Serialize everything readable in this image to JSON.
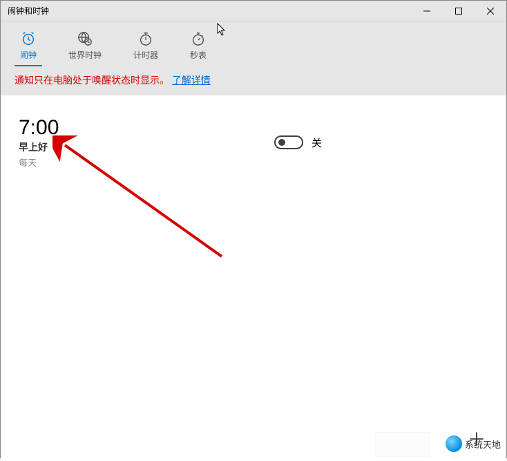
{
  "window": {
    "title": "闹钟和时钟"
  },
  "tabs": {
    "alarm": "闹钟",
    "world_clock": "世界时钟",
    "timer": "计时器",
    "stopwatch": "秒表"
  },
  "notice": {
    "text": "通知只在电脑处于唤醒状态时显示。",
    "link": "了解详情"
  },
  "alarm": {
    "time": "7:00",
    "name": "早上好",
    "repeat": "每天",
    "toggle_state": "关"
  },
  "add_button": "＋",
  "watermark": {
    "text": "系统天地"
  }
}
